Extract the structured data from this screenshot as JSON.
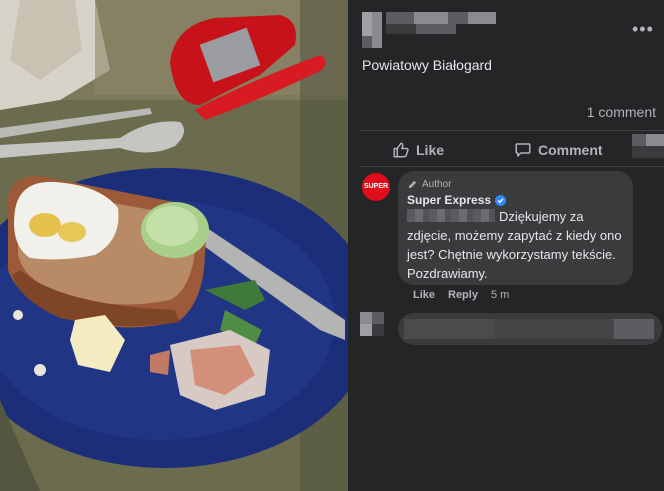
{
  "post": {
    "page_name": "Powiatowy Białogard",
    "comment_count": "1 comment",
    "more_icon_glyph": "•••"
  },
  "actions": {
    "like_label": "Like",
    "comment_label": "Comment",
    "like_icon": "thumb-up-icon",
    "comment_icon": "speech-bubble-icon"
  },
  "comment": {
    "author_badge": "Author",
    "commenter_name": "Super Express",
    "avatar_text": "SUPER",
    "text": "Dziękujemy za zdjęcie, możemy zapytać z kiedy ono jest? Chętnie wykorzystamy tekście. Pozdrawiamy.",
    "like_label": "Like",
    "reply_label": "Reply",
    "timestamp": "5 m"
  },
  "colors": {
    "panel_bg": "#242526",
    "bubble_bg": "#3a3b3c",
    "brand_red": "#e00d1c",
    "verified_blue": "#2d88ff"
  }
}
